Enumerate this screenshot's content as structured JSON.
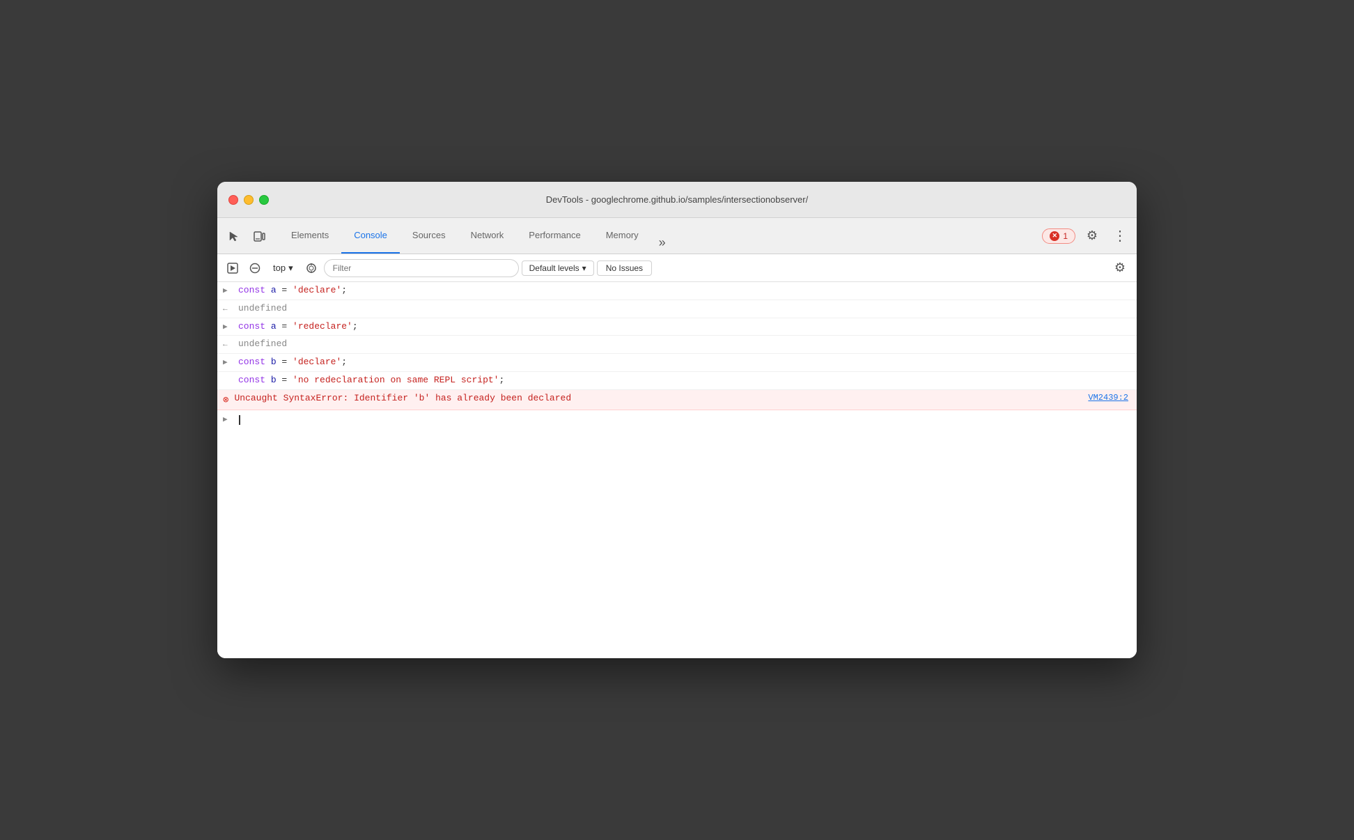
{
  "window": {
    "title": "DevTools - googlechrome.github.io/samples/intersectionobserver/"
  },
  "tabs": {
    "items": [
      {
        "label": "Elements",
        "active": false
      },
      {
        "label": "Console",
        "active": true
      },
      {
        "label": "Sources",
        "active": false
      },
      {
        "label": "Network",
        "active": false
      },
      {
        "label": "Performance",
        "active": false
      },
      {
        "label": "Memory",
        "active": false
      }
    ],
    "more_label": "»"
  },
  "error_badge": {
    "count": "1"
  },
  "toolbar": {
    "context": "top",
    "filter_placeholder": "Filter",
    "levels_label": "Default levels",
    "no_issues_label": "No Issues"
  },
  "console": {
    "lines": [
      {
        "type": "input",
        "content": "const a = 'declare';"
      },
      {
        "type": "output",
        "content": "undefined"
      },
      {
        "type": "input",
        "content": "const a = 'redeclare';"
      },
      {
        "type": "output",
        "content": "undefined"
      },
      {
        "type": "input",
        "content": "const b = 'declare';"
      },
      {
        "type": "input-continuation",
        "content": "const b = 'no redeclaration on same REPL script';"
      },
      {
        "type": "error",
        "content": "Uncaught SyntaxError: Identifier 'b' has already been declared",
        "file_link": "VM2439:2"
      }
    ]
  }
}
